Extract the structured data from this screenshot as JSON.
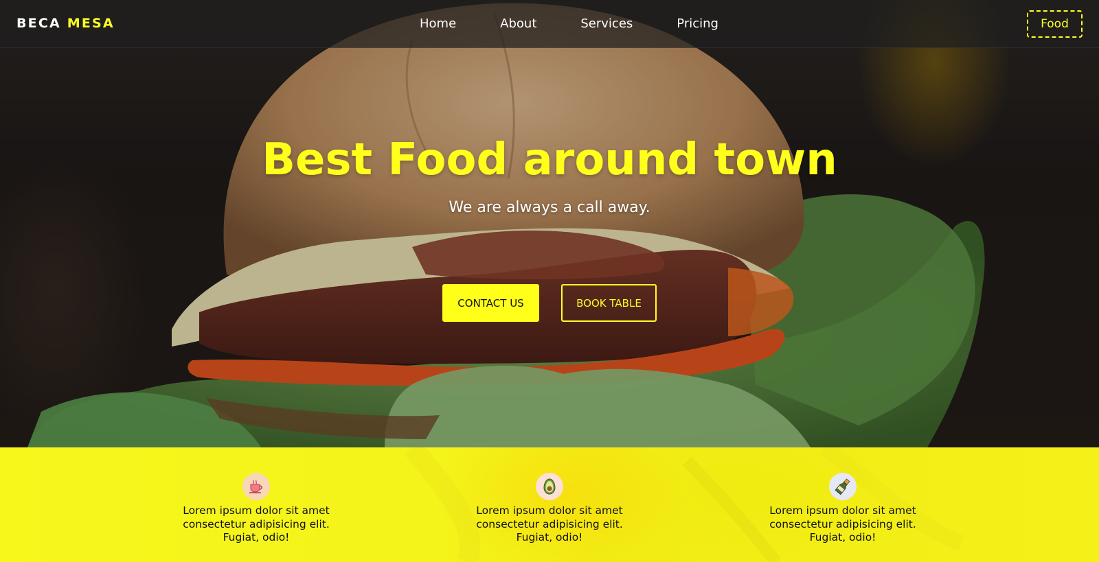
{
  "brand": {
    "word1": "BECA",
    "word2": "MESA"
  },
  "nav": {
    "links": [
      {
        "label": "Home"
      },
      {
        "label": "About"
      },
      {
        "label": "Services"
      },
      {
        "label": "Pricing"
      }
    ],
    "food_button": "Food"
  },
  "hero": {
    "title": "Best Food around town",
    "subtitle": "We are always a call away.",
    "contact_button": "CONTACT US",
    "book_button": "BOOK TABLE"
  },
  "features": [
    {
      "icon": "coffee-cup-icon",
      "text": "Lorem ipsum dolor sit amet consectetur adipisicing elit. Fugiat, odio!"
    },
    {
      "icon": "avocado-icon",
      "text": "Lorem ipsum dolor sit amet consectetur adipisicing elit. Fugiat, odio!"
    },
    {
      "icon": "champagne-bottle-icon",
      "text": "Lorem ipsum dolor sit amet consectetur adipisicing elit. Fugiat, odio!"
    }
  ],
  "colors": {
    "accent_yellow": "#ffff1c",
    "nav_background": "#1e1e1e",
    "strip_yellow": "#f5f31a"
  }
}
